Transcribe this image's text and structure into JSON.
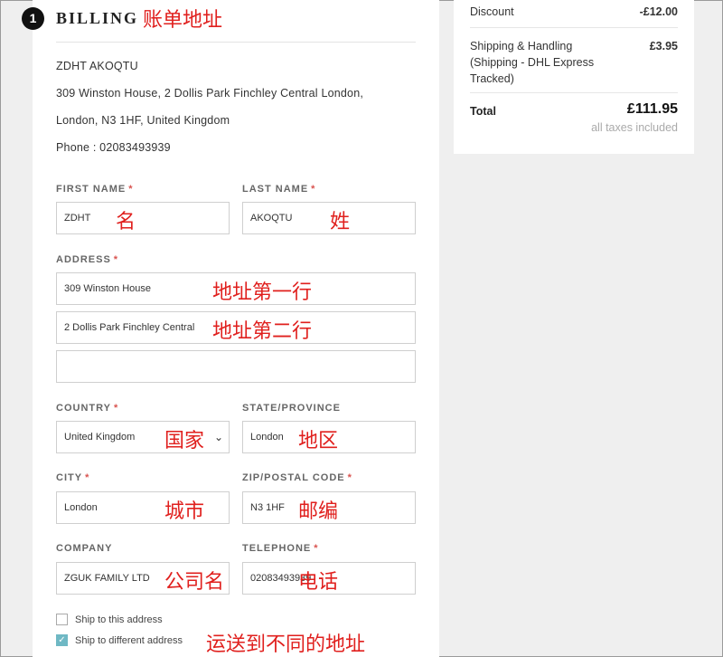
{
  "billing": {
    "step_number": "1",
    "title": "BILLING",
    "title_note": "账单地址",
    "address_block": {
      "name": "ZDHT AKOQTU",
      "line1": "309 Winston House, 2 Dollis Park Finchley Central London,",
      "line2": "London, N3 1HF, United Kingdom",
      "phone": "Phone : 02083493939"
    },
    "form": {
      "first_name": {
        "label": "FIRST NAME",
        "value": "ZDHT",
        "note": "名"
      },
      "last_name": {
        "label": "LAST NAME",
        "value": "AKOQTU",
        "note": "姓"
      },
      "address": {
        "label": "ADDRESS",
        "line1": "309 Winston House",
        "line1_note": "地址第一行",
        "line2": "2 Dollis Park Finchley Central",
        "line2_note": "地址第二行",
        "line3": ""
      },
      "country": {
        "label": "COUNTRY",
        "value": "United Kingdom",
        "note": "国家"
      },
      "state": {
        "label": "STATE/PROVINCE",
        "value": "London",
        "note": "地区"
      },
      "city": {
        "label": "CITY",
        "value": "London",
        "note": "城市"
      },
      "zip": {
        "label": "ZIP/POSTAL CODE",
        "value": "N3 1HF",
        "note": "邮编"
      },
      "company": {
        "label": "COMPANY",
        "value": "ZGUK FAMILY LTD",
        "note": "公司名"
      },
      "telephone": {
        "label": "TELEPHONE",
        "value": "02083493939",
        "note": "电话"
      },
      "required_mark": "*"
    },
    "ship_same": {
      "label": "Ship to this address",
      "checked": false
    },
    "ship_different": {
      "label": "Ship to different address",
      "checked": true,
      "note": "运送到不同的地址"
    }
  },
  "summary": {
    "discount_label": "Discount",
    "discount_value": "-£12.00",
    "shipping_label_1": "Shipping & Handling",
    "shipping_label_2": "(Shipping - DHL Express",
    "shipping_label_3": "Tracked)",
    "shipping_value": "£3.95",
    "total_label": "Total",
    "total_value": "£111.95",
    "tax_note": "all taxes included"
  },
  "icons": {
    "check": "✓",
    "caret": "⌄"
  },
  "colors": {
    "annotation": "#e0201e",
    "required": "#d9534f",
    "checkbox": "#6fb8c4"
  }
}
